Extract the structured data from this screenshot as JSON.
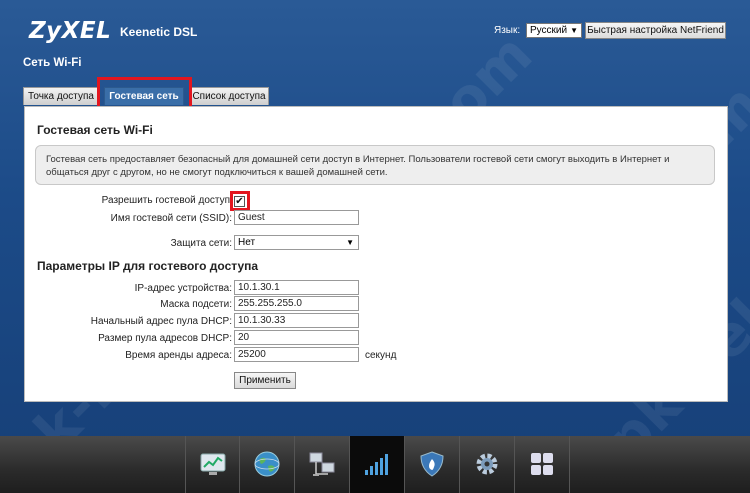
{
  "header": {
    "logo": "ZyXEL",
    "model": "Keenetic DSL",
    "language_label": "Язык:",
    "language_value": "Русский",
    "quick_setup_button": "Быстрая настройка NetFriend"
  },
  "page_title": "Сеть Wi-Fi",
  "tabs": [
    {
      "label": "Точка доступа",
      "active": false
    },
    {
      "label": "Гостевая сеть",
      "active": true
    },
    {
      "label": "Список доступа",
      "active": false
    }
  ],
  "guest": {
    "section_title": "Гостевая сеть Wi-Fi",
    "info_line1": "Гостевая сеть предоставляет безопасный для домашней сети доступ в Интернет. Пользователи гостевой сети смогут выходить в Интернет и",
    "info_line2": "общаться друг с другом, но не смогут подключиться к вашей домашней сети.",
    "allow_label": "Разрешить гостевой доступ",
    "allow_checked": true,
    "allow_check_mark": "✔",
    "ssid_label": "Имя гостевой сети (SSID):",
    "ssid_value": "Guest",
    "security_label": "Защита сети:",
    "security_value": "Нет"
  },
  "ip": {
    "section_title": "Параметры IP для гостевого доступа",
    "fields": [
      {
        "label": "IP-адрес устройства:",
        "value": "10.1.30.1"
      },
      {
        "label": "Маска подсети:",
        "value": "255.255.255.0"
      },
      {
        "label": "Начальный адрес пула DHCP:",
        "value": "10.1.30.33"
      },
      {
        "label": "Размер пула адресов DHCP:",
        "value": "20"
      },
      {
        "label": "Время аренды адреса:",
        "value": "25200"
      }
    ],
    "lease_unit": "секунд",
    "apply_button": "Применить"
  },
  "watermark": "pk-help.com",
  "footer": {
    "icons": [
      "monitor-chart-icon",
      "globe-icon",
      "network-computers-icon",
      "wifi-signal-icon",
      "shield-fire-icon",
      "gear-icon",
      "apps-grid-icon"
    ],
    "active_icon": "wifi-signal-icon"
  },
  "colors": {
    "highlight": "#e3161f",
    "active_tab": "#3a6ea8",
    "background": "#1c4b88"
  }
}
